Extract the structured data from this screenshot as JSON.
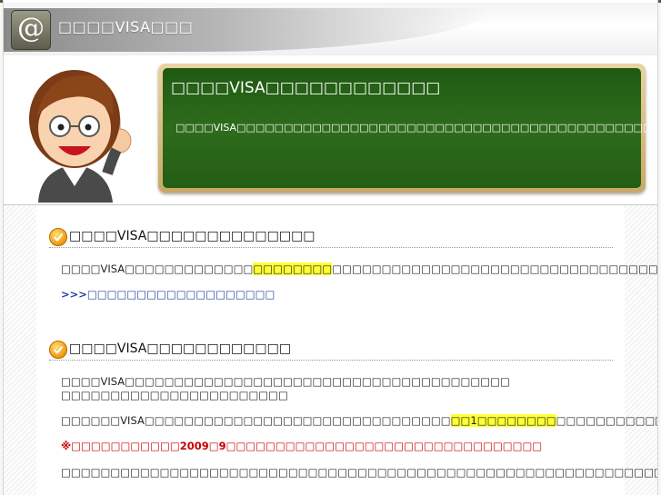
{
  "header": {
    "logo_glyph": "@",
    "site_title": "□□□□VISA□□□"
  },
  "hero": {
    "board_title": "□□□□VISA□□□□□□□□□□□□",
    "board_text": "□□□□VISA□□□□□□□□□□□□□□□□□□□□□□□□□□□□□□□□□□□□□□□□□□□□□□□□□□□□□□□□□□□□□VISA□□□□□□□□□□□□□"
  },
  "sections": [
    {
      "title": "□□□□VISA□□□□□□□□□□□□□□",
      "para1_a": "□□□□VISA□□□□□□□□□□□□□",
      "para1_hl": "□□□□□□□□",
      "para1_b": "□□□□□□□□□□□□□□□□□□□□□□□□□□□□□□□□□",
      "link": ">>>□□□□□□□□□□□□□□□□□□□"
    },
    {
      "title": "□□□□VISA□□□□□□□□□□□□",
      "para1_line1": "□□□□VISA□□□□□□□□□□□□□□□□□□□□□□□□□□□□□□□□□□□□□□□",
      "para1_line2": "□□□□□□□□□□□□□□□□□□□□□□□",
      "para2_a": "□□□□□□VISA□□□□□□□□□□□□□□□□□□□□□□□□□□□□□□□",
      "para2_hl": "□□1□□□□□□□□",
      "para2_b": "□□□□□□□□□□□",
      "note": "※□□□□□□□□□□□2009□9□□□□□□□□□□□□□□□□□□□□□□□□□□□□□□□□",
      "para3": "□□□□□□□□□□□□□□□□□□□□□□□□□□□□□□□□□□□□□□□□□□□□□□□□□□□□□□□□□□□□□□□□□□□□□□VISA□□□□□□□□□□□"
    }
  ]
}
